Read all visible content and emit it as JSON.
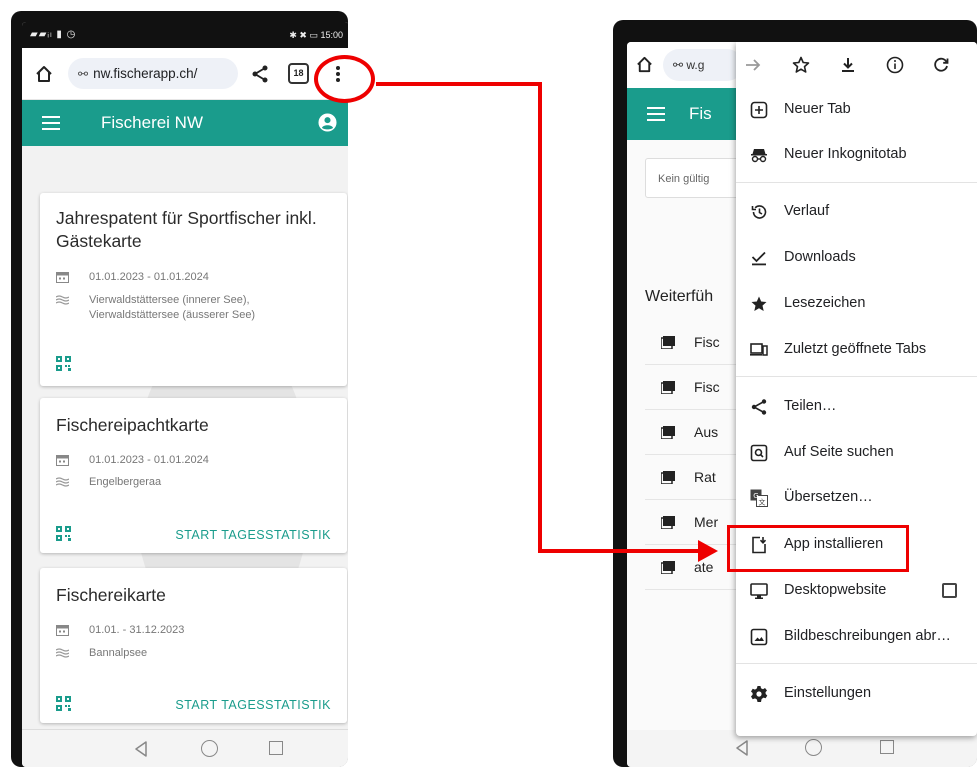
{
  "left_phone": {
    "status": {
      "left": "▰▰ᵢₗ ▮ ◷",
      "right": "✱ ✖ ▭ 15:00"
    },
    "url": "nw.fischerapp.ch/",
    "tab_count": "18",
    "app_title": "Fischerei NW",
    "cards": [
      {
        "title": "Jahrespatent für Sportfischer inkl. Gästekarte",
        "dates": "01.01.2023 - 01.01.2024",
        "waters": "Vierwaldstättersee (innerer See), Vierwaldstättersee (äusserer See)",
        "action": ""
      },
      {
        "title": "Fischereipachtkarte",
        "dates": "01.01.2023 - 01.01.2024",
        "waters": "Engelbergeraa",
        "action": "START TAGESSTATISTIK"
      },
      {
        "title": "Fischereikarte",
        "dates": "01.01. - 31.12.2023",
        "waters": "Bannalpsee",
        "action": "START TAGESSTATISTIK"
      }
    ]
  },
  "right_phone": {
    "url_partial": "w.g",
    "app_title_partial": "Fis",
    "input_placeholder": "Kein gültig",
    "section_title": "Weiterfüh",
    "list_items": [
      "Fisc",
      "Fisc",
      "Aus",
      "Rat",
      "Mer",
      "ate"
    ],
    "menu": {
      "items": [
        {
          "label": "Neuer Tab",
          "icon": "new-tab-icon"
        },
        {
          "label": "Neuer Inkognitotab",
          "icon": "incognito-icon"
        },
        {
          "label": "Verlauf",
          "icon": "history-icon"
        },
        {
          "label": "Downloads",
          "icon": "downloads-icon"
        },
        {
          "label": "Lesezeichen",
          "icon": "bookmarks-star-icon"
        },
        {
          "label": "Zuletzt geöffnete Tabs",
          "icon": "recent-tabs-icon"
        },
        {
          "label": "Teilen…",
          "icon": "share-icon"
        },
        {
          "label": "Auf Seite suchen",
          "icon": "find-in-page-icon"
        },
        {
          "label": "Übersetzen…",
          "icon": "translate-icon"
        },
        {
          "label": "App installieren",
          "icon": "install-app-icon"
        },
        {
          "label": "Desktopwebsite",
          "icon": "desktop-icon"
        },
        {
          "label": "Bildbeschreibungen abr…",
          "icon": "image-description-icon"
        },
        {
          "label": "Einstellungen",
          "icon": "settings-gear-icon"
        }
      ]
    }
  },
  "colors": {
    "teal": "#1a9c8c",
    "highlight": "#e00000"
  }
}
